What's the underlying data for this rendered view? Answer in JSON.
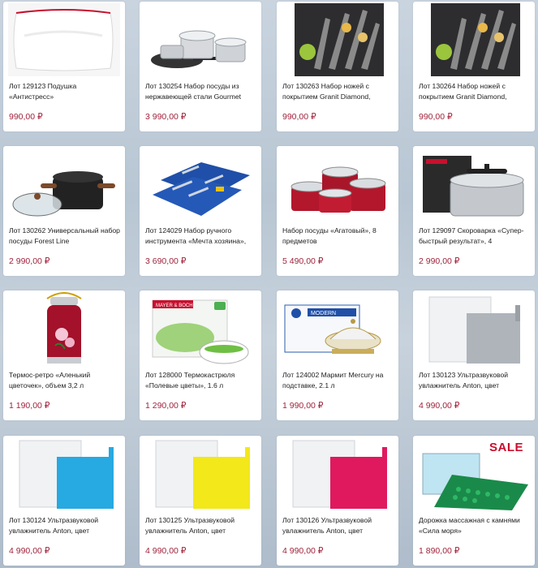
{
  "products": [
    {
      "title": "Лот 129123 Подушка «Антистресс»",
      "price": "990,00 ₽",
      "image": "pillow"
    },
    {
      "title": "Лот 130254 Набор посуды из нержавеющей стали Gourmet",
      "price": "3 990,00 ₽",
      "image": "cookware-steel"
    },
    {
      "title": "Лот 130263 Набор ножей с покрытием Granit Diamond,",
      "price": "990,00 ₽",
      "image": "knife-set"
    },
    {
      "title": "Лот 130264 Набор ножей с покрытием Granit Diamond,",
      "price": "990,00 ₽",
      "image": "knife-set"
    },
    {
      "title": "Лот 130262 Универсальный набор посуды Forest Line",
      "price": "2 990,00 ₽",
      "image": "pot-black"
    },
    {
      "title": "Лот 124029 Набор ручного инструмента «Мечта хозяина»,",
      "price": "3 690,00 ₽",
      "image": "tool-case"
    },
    {
      "title": "Набор посуды «Агатовый», 8 предметов",
      "price": "5 490,00 ₽",
      "image": "pots-red"
    },
    {
      "title": "Лот 129097 Скороварка «Супер-быстрый результат», 4",
      "price": "2 990,00 ₽",
      "image": "pressure-cooker"
    },
    {
      "title": "Термос-ретро «Аленький цветочек», объем 3,2 л",
      "price": "1 190,00 ₽",
      "image": "thermos"
    },
    {
      "title": "Лот 128000 Термокастрюля «Полевые цветы», 1.6 л",
      "price": "1 290,00 ₽",
      "image": "thermo-pot"
    },
    {
      "title": "Лот 124002 Мармит Mercury на подставке, 2.1 л",
      "price": "1 990,00 ₽",
      "image": "chafing-dish"
    },
    {
      "title": "Лот 130123 Ультразвуковой увлажнитель Anton, цвет",
      "price": "4 990,00 ₽",
      "image": "humidifier-grey"
    },
    {
      "title": "Лот 130124 Ультразвуковой увлажнитель Anton, цвет",
      "price": "4 990,00 ₽",
      "image": "humidifier-blue"
    },
    {
      "title": "Лот 130125 Ультразвуковой увлажнитель Anton, цвет",
      "price": "4 990,00 ₽",
      "image": "humidifier-yellow"
    },
    {
      "title": "Лот 130126 Ультразвуковой увлажнитель Anton, цвет",
      "price": "4 990,00 ₽",
      "image": "humidifier-pink"
    },
    {
      "title": "Дорожка массажная с камнями «Сила моря»",
      "price": "1 890,00 ₽",
      "image": "massage-mat"
    }
  ],
  "badges": {
    "sale": "SALE"
  },
  "images": {
    "thermo_pot_brand": "MAYER & BOCH",
    "chafing_dish_brand": "MODERN"
  },
  "colors": {
    "price": "#a0243c",
    "card": "#ffffff",
    "background": "#c7d2dc",
    "sale": "#c8102e"
  }
}
